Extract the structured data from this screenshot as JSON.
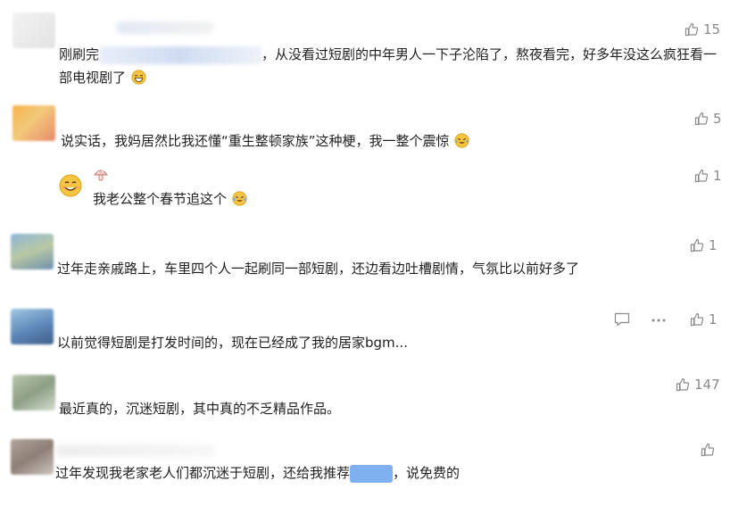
{
  "comments": [
    {
      "id": "c1",
      "text_prefix": "刚刷完",
      "text_suffix": "，从没看过短剧的中年男人一下子沦陷了，熬夜看完，好多年没这么疯狂看一部电视剧了",
      "emoji": "grin-emoji",
      "likes": "15"
    },
    {
      "id": "c2",
      "text": "说实话，我妈居然比我还懂“重生整顿家族”这种梗，我一整个震惊",
      "emoji": "laugh-cry-emoji",
      "likes": "5"
    },
    {
      "id": "c3",
      "text": "我老公整个春节追这个",
      "emoji": "laugh-cry-emoji",
      "likes": "1"
    },
    {
      "id": "c4",
      "text": "过年走亲戚路上，车里四个人一起刷同一部短剧，还边看边吐槽剧情，气氛比以前好多了",
      "likes": "1"
    },
    {
      "id": "c5",
      "text": "以前觉得短剧是打发时间的，现在已经成了我的居家bgm...",
      "likes": "1"
    },
    {
      "id": "c6",
      "text": "最近真的，沉迷短剧，其中真的不乏精品作品。",
      "likes": "147"
    },
    {
      "id": "c7",
      "text_prefix": "过年发现我老家老人们都沉迷于短剧，还给我推荐",
      "text_suffix": "，说免费的",
      "likes": ""
    }
  ],
  "colors": {
    "like_gray": "#8a8a8a",
    "redaction_blue": "#7fb0f0",
    "emoji_yellow": "#f5c542"
  },
  "icons": {
    "like": "thumbs-up-icon",
    "reply": "comment-icon",
    "more": "more-dots-icon"
  }
}
